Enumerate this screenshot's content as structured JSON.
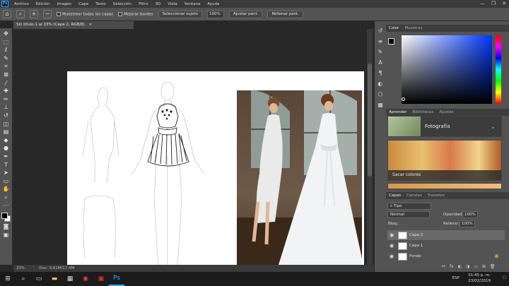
{
  "app": {
    "logo": "Ps"
  },
  "menu": [
    "Archivo",
    "Edición",
    "Imagen",
    "Capa",
    "Texto",
    "Selección",
    "Filtro",
    "3D",
    "Vista",
    "Ventana",
    "Ayuda"
  ],
  "options_bar": {
    "sample_all_layers": "Muestrear todas las capas",
    "enhance_edge": "Mejorar bordes",
    "select_subject": "Seleccionar sujeto",
    "zoom_value": "100%",
    "fit_screen": "Ajustar pant.",
    "fill_screen": "Rellenar pant."
  },
  "document": {
    "tab_title": "Sin título-1 al 33% (Capa 2, RGB/8)",
    "status_zoom": "33%",
    "status_doc": "Doc: 9,61M/17,4M"
  },
  "color_panel": {
    "tabs": [
      "Color",
      "Muestras"
    ],
    "active": 0,
    "hue_accent": "#0037ff"
  },
  "learn_panel": {
    "tabs": [
      "Aprender",
      "Bibliotecas",
      "Ajustes"
    ],
    "active": 0,
    "cards": [
      {
        "title": "Fotografía"
      },
      {
        "title": "Sacar colores"
      }
    ]
  },
  "layers_panel": {
    "tabs": [
      "Capas",
      "Canales",
      "Trazados"
    ],
    "active": 0,
    "filter": "Tipo",
    "blend_mode": "Normal",
    "opacity_label": "Opacidad:",
    "opacity_value": "100%",
    "lock_label": "Bloq.:",
    "fill_label": "Relleno:",
    "fill_value": "100%",
    "layers": [
      {
        "name": "Capa 2",
        "selected": true
      },
      {
        "name": "Capa 1",
        "selected": false
      },
      {
        "name": "Fondo",
        "selected": false
      }
    ]
  },
  "taskbar": {
    "lang": "ESP",
    "time": "01:45 p. m.",
    "date": "23/02/2019"
  }
}
